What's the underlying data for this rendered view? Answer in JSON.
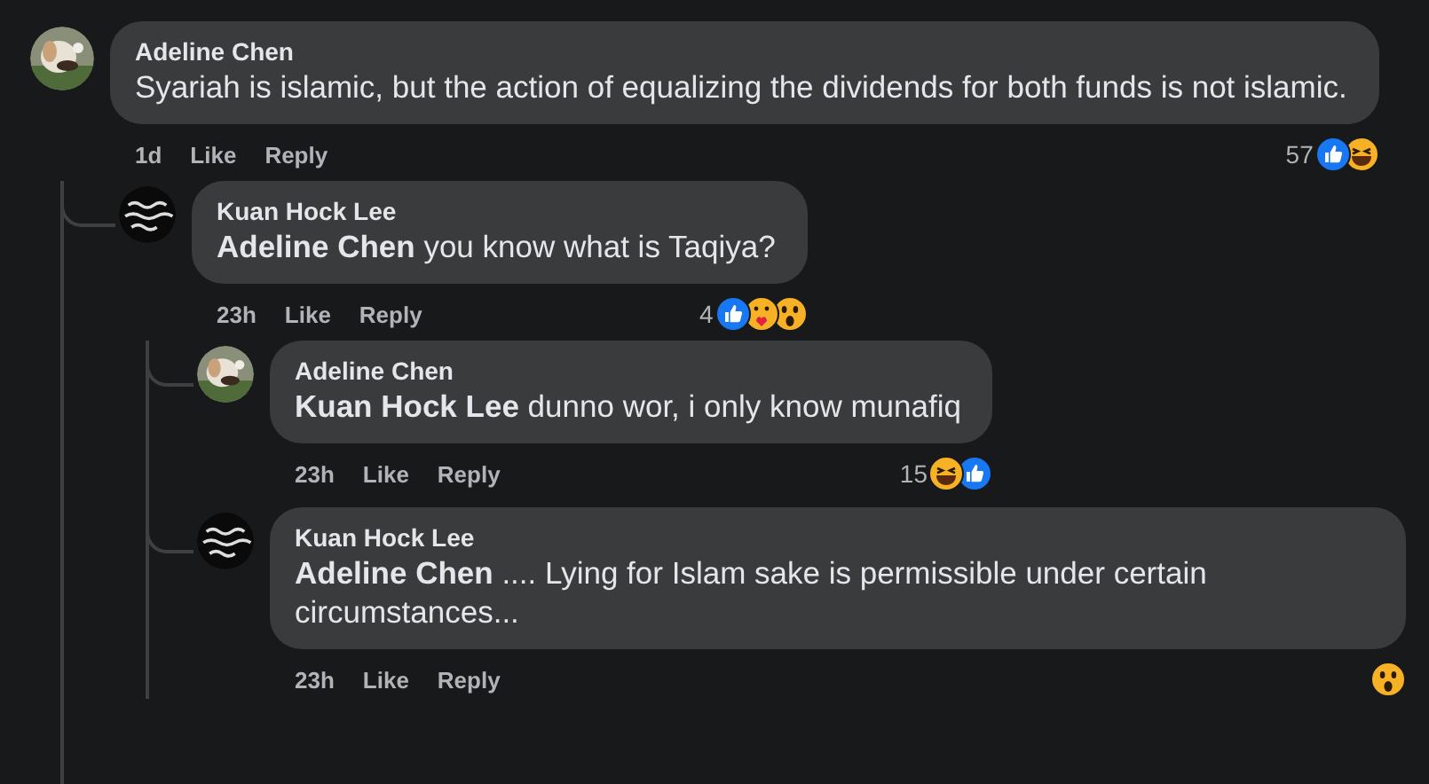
{
  "comments": [
    {
      "author": "Adeline Chen",
      "text": "Syariah is islamic, but the action of equalizing the dividends for both funds is not islamic.",
      "time": "1d",
      "actions": [
        "Like",
        "Reply"
      ],
      "reaction_count": "57",
      "reactions": [
        {
          "kind": "like"
        },
        {
          "kind": "haha"
        }
      ],
      "children": [
        {
          "author": "Kuan Hock Lee",
          "text": "**Adeline Chen** you know what is Taqiya?",
          "time": "23h",
          "actions": [
            "Like",
            "Reply"
          ],
          "reaction_count": "4",
          "reactions": [
            {
              "kind": "like"
            },
            {
              "kind": "care"
            },
            {
              "kind": "wow"
            }
          ],
          "children": [
            {
              "author": "Adeline Chen",
              "text": "**Kuan Hock Lee** dunno wor, i only know munafiq",
              "time": "23h",
              "actions": [
                "Like",
                "Reply"
              ],
              "reaction_count": "15",
              "reactions": [
                {
                  "kind": "haha"
                },
                {
                  "kind": "like"
                }
              ]
            },
            {
              "author": "Kuan Hock Lee",
              "text": "**Adeline Chen** .... Lying for Islam sake is permissible under certain circumstances...",
              "time": "23h",
              "actions": [
                "Like",
                "Reply"
              ],
              "reactions": [
                {
                  "kind": "wow"
                }
              ]
            }
          ]
        }
      ]
    }
  ]
}
